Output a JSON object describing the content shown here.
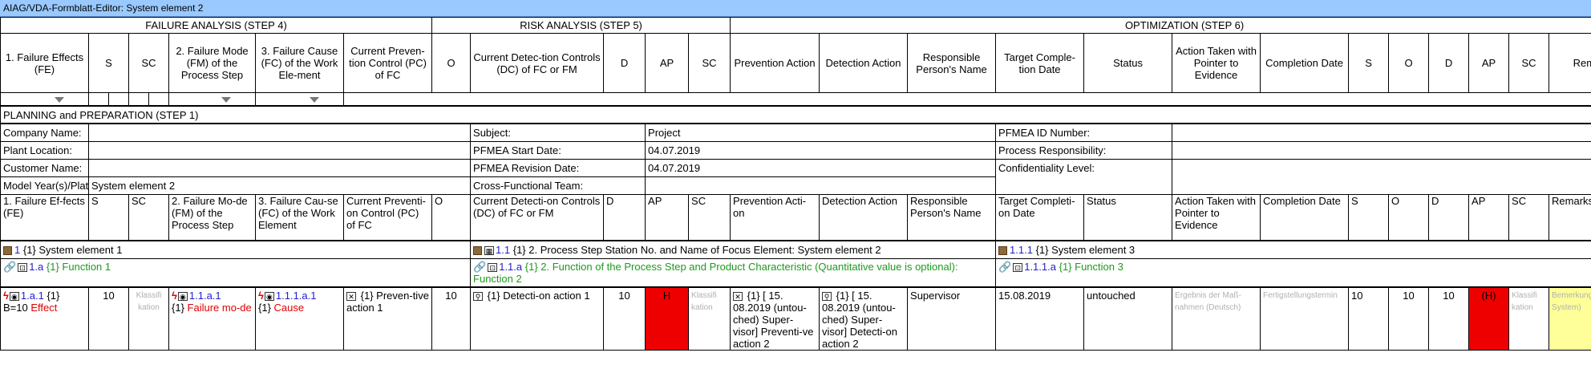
{
  "window": {
    "title": "AIAG/VDA-Formblatt-Editor: System element 2"
  },
  "sections": {
    "failure_analysis": "FAILURE ANALYSIS (STEP 4)",
    "risk_analysis": "RISK ANALYSIS (STEP 5)",
    "optimization": "OPTIMIZATION  (STEP 6)"
  },
  "headers": {
    "fe": "1. Failure Effects (FE)",
    "s": "S",
    "sc": "SC",
    "fm": "2. Failure Mode (FM) of the Process Step",
    "fc": "3. Failure Cause (FC) of the Work Ele-ment",
    "pc": "Current Preven-tion Control (PC) of FC",
    "o": "O",
    "dc": "Current Detec-tion Controls (DC) of FC or FM",
    "d": "D",
    "ap": "AP",
    "sc2": "SC",
    "prev_action": "Prevention Action",
    "det_action": "Detection Action",
    "resp": "Responsible Person's Name",
    "target": "Target Comple-tion Date",
    "status": "Status",
    "action_taken": "Action Taken with Pointer to Evidence",
    "completion": "Completion Date",
    "s2": "S",
    "o2": "O",
    "d2": "D",
    "ap2": "AP",
    "sc3": "SC",
    "remarks": "Remarks"
  },
  "planning": {
    "title": "PLANNING and PREPARATION (STEP 1)",
    "company_label": "Company Name:",
    "plant_label": "Plant Location:",
    "customer_label": "Customer Name:",
    "model_label": "Model Year(s)/Platform(s):",
    "model_value": "System element 2",
    "subject_label": "Subject:",
    "subject_value": "Project",
    "start_label": "PFMEA Start Date:",
    "start_value": "04.07.2019",
    "revision_label": "PFMEA Revision Date:",
    "revision_value": "04.07.2019",
    "team_label": "Cross-Functional Team:",
    "id_label": "PFMEA ID Number:",
    "resp_label": "Process Responsibility:",
    "conf_label": "Confidentiality Level:"
  },
  "colheaders": {
    "fe": "1. Failure Ef-fects (FE)",
    "s": "S",
    "sc": "SC",
    "fm": "2. Failure Mo-de (FM) of the Process Step",
    "fc": "3. Failure Cau-se (FC) of the Work Element",
    "pc": "Current Preventi-on Control (PC) of FC",
    "o": "O",
    "dc": "Current Detecti-on Controls (DC) of FC or FM",
    "d": "D",
    "ap": "AP",
    "sc2": "SC",
    "prev": "Prevention Acti-on",
    "det": "Detection Action",
    "resp": "Responsible Person's Name",
    "target": "Target Completi-on Date",
    "status": "Status",
    "taken": "Action Taken with Pointer to Evidence",
    "completion": "Completion Date",
    "s2": "S",
    "o2": "O",
    "d2": "D",
    "ap2": "AP",
    "sc3": "SC",
    "remarks": "Remarks"
  },
  "elements": {
    "e1_num": "1",
    "e1_text": "{1} System element 1",
    "e2_num": "1.1",
    "e2_text": "{1} 2. Process Step Station No. and Name of Focus Element: System element 2",
    "e3_num": "1.1.1",
    "e3_text": "{1} System element 3",
    "f1_num": "1.a",
    "f1_text": "{1} Function 1",
    "f2_num": "1.1.a",
    "f2_text": "{1} 2. Function of the Process Step and Product Characteristic (Quantitative value is optional): Function 2",
    "f3_num": "1.1.1.a",
    "f3_text": "{1} Function 3"
  },
  "row": {
    "fe_num": "1.a.1",
    "fe_count": "{1}",
    "fe_b": "B=10",
    "fe_text": "Effect",
    "s": "10",
    "sc": "Klassifi kation",
    "fm_num": "1.1.a.1",
    "fm_count": "{1}",
    "fm_text": "Failure mo-de",
    "fc_num": "1.1.1.a.1",
    "fc_count": "{1}",
    "fc_text": "Cause",
    "pc_count": "{1}",
    "pc_text": "Preven-tive action 1",
    "o": "10",
    "dc_count": "{1}",
    "dc_text": "Detecti-on action 1",
    "d": "10",
    "ap": "H",
    "sc2": "Klassifi kation",
    "prev_text": "{1} [ 15. 08.2019 (untou-ched) Super-visor] Preventi-ve action 2",
    "det_text": "{1} [ 15. 08.2019 (untou-ched) Super-visor] Detecti-on action 2",
    "resp": "Supervisor",
    "target": "15.08.2019",
    "status": "untouched",
    "taken": "Ergebnis der Maß-nahmen (Deutsch)",
    "completion": "Fertigstellungstermin",
    "s2": "10",
    "o2": "10",
    "d2": "10",
    "ap2": "(H)",
    "sc3": "Klassifi kation",
    "remarks": "Bemerkung (English, System)"
  },
  "colors": {
    "titlebar": "#99c9ff",
    "ap_high": "#ee0000",
    "remarks_bg": "#ffff99"
  }
}
